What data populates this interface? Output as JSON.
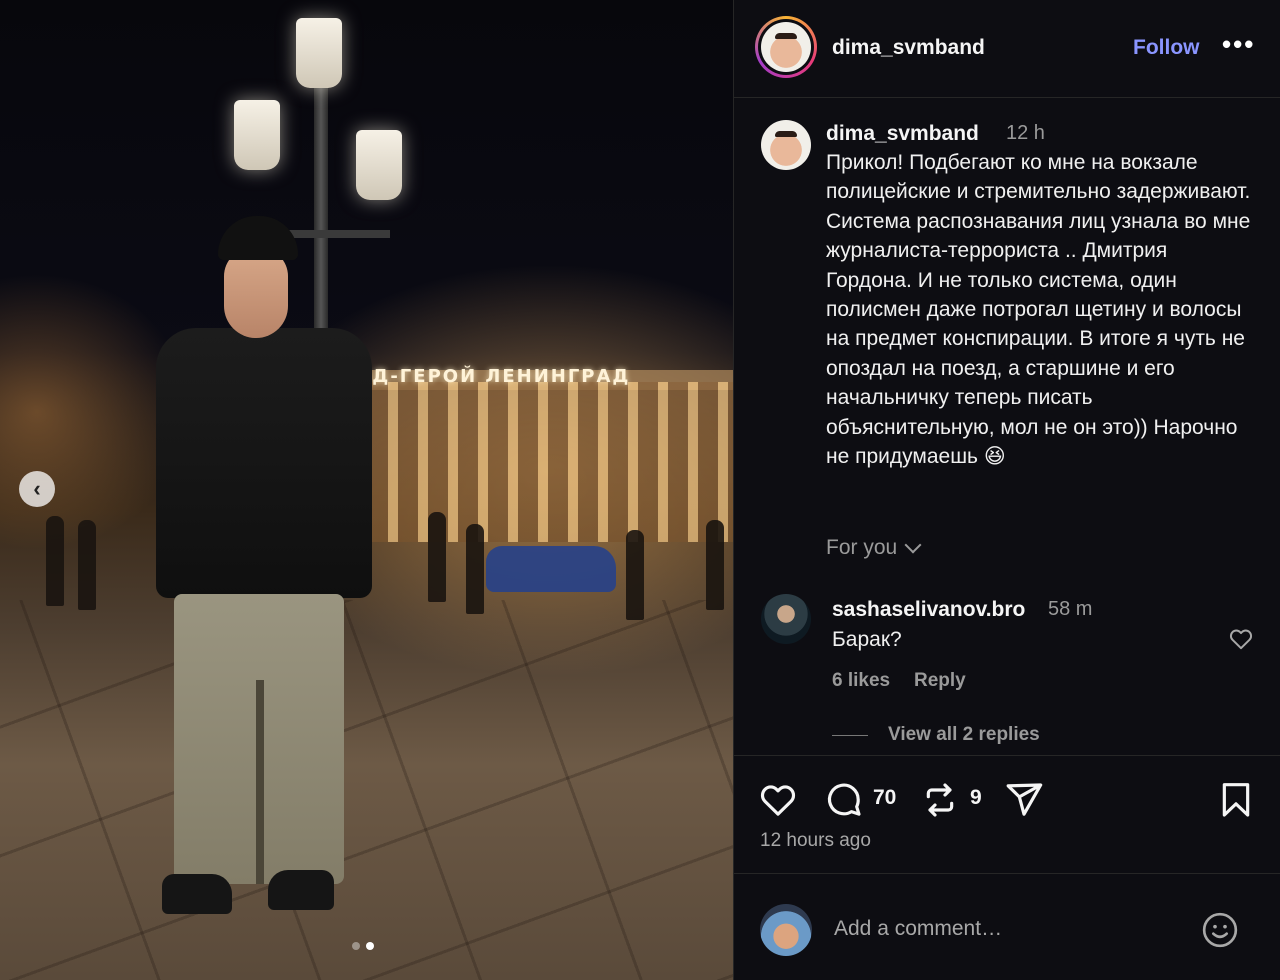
{
  "post": {
    "author": "dima_svmband",
    "follow_label": "Follow",
    "more_label": "•••",
    "photo": {
      "sign_text": "ОД-ГЕРОЙ ЛЕНИНГРАД",
      "carousel": {
        "count": 2,
        "active": 2
      },
      "prev_arrow": "‹"
    }
  },
  "caption": {
    "username": "dima_svmband",
    "time": "12 h",
    "text": "Прикол! Подбегают ко мне на вокзале полицейские и стремительно задерживают. Система распознавания лиц узнала во мне журналиста-террориста .. Дмитрия Гордона. И не только система, один полисмен даже потрогал щетину и волосы на предмет конспирации. В итоге я чуть не опоздал на поезд, а старшине и его начальничку теперь писать объяснительную, мол не он это)) Нарочно не придумаешь 😆",
    "for_you_label": "For you"
  },
  "comment": {
    "username": "sashaselivanov.bro",
    "time": "58 m",
    "text": "Барак?",
    "likes": "6 likes",
    "reply_label": "Reply",
    "view_replies": "View all 2 replies"
  },
  "actions": {
    "comments_count": "70",
    "reposts_count": "9",
    "time_ago": "12 hours ago"
  },
  "add_comment": {
    "placeholder": "Add a comment…"
  },
  "icons": {
    "like": "heart-icon",
    "comment": "comment-bubble-icon",
    "repost": "repost-icon",
    "share": "send-icon",
    "save": "bookmark-icon",
    "emoji": "emoji-icon",
    "more": "more-options-icon",
    "prev": "chevron-left-icon"
  },
  "colors": {
    "follow": "#8a95ff",
    "background": "#0d0d12",
    "muted_text": "#9a9a9a"
  }
}
